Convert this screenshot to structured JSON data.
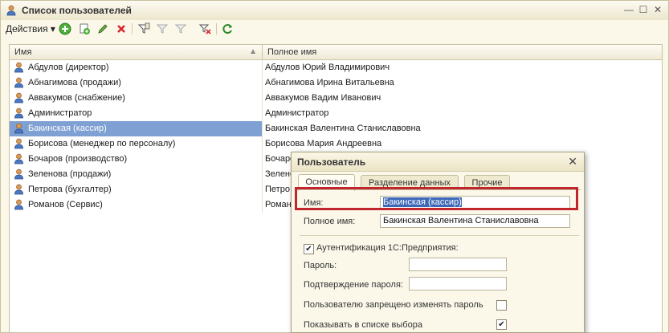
{
  "window": {
    "title": "Список пользователей"
  },
  "toolbar": {
    "actions_label": "Действия"
  },
  "grid": {
    "col_name": "Имя",
    "col_fullname": "Полное имя",
    "rows": [
      {
        "name": "Абдулов (директор)",
        "fullname": "Абдулов Юрий Владимирович"
      },
      {
        "name": "Абнагимова (продажи)",
        "fullname": "Абнагимова Ирина Витальевна"
      },
      {
        "name": "Аввакумов (снабжение)",
        "fullname": "Аввакумов Вадим Иванович"
      },
      {
        "name": "Администратор",
        "fullname": "Администратор"
      },
      {
        "name": "Бакинская (кассир)",
        "fullname": "Бакинская Валентина Станиславовна"
      },
      {
        "name": "Борисова (менеджер по персоналу)",
        "fullname": "Борисова Мария Андреевна"
      },
      {
        "name": "Бочаров (производство)",
        "fullname": "Бочаро"
      },
      {
        "name": "Зеленова (продажи)",
        "fullname": "Зелено"
      },
      {
        "name": "Петрова (бухгалтер)",
        "fullname": "Петро"
      },
      {
        "name": "Романов (Сервис)",
        "fullname": "Романо"
      }
    ]
  },
  "dialog": {
    "title": "Пользователь",
    "tabs": [
      "Основные",
      "Разделение данных",
      "Прочие"
    ],
    "name_label": "Имя:",
    "name_value": "Бакинская (кассир)",
    "fullname_label": "Полное имя:",
    "fullname_value": "Бакинская Валентина Станиславовна",
    "auth_label": "Аутентификация 1С:Предприятия:",
    "password_label": "Пароль:",
    "password_confirm_label": "Подтверждение пароля:",
    "forbid_change_label": "Пользователю запрещено изменять пароль",
    "show_in_list_label": "Показывать в списке выбора"
  }
}
